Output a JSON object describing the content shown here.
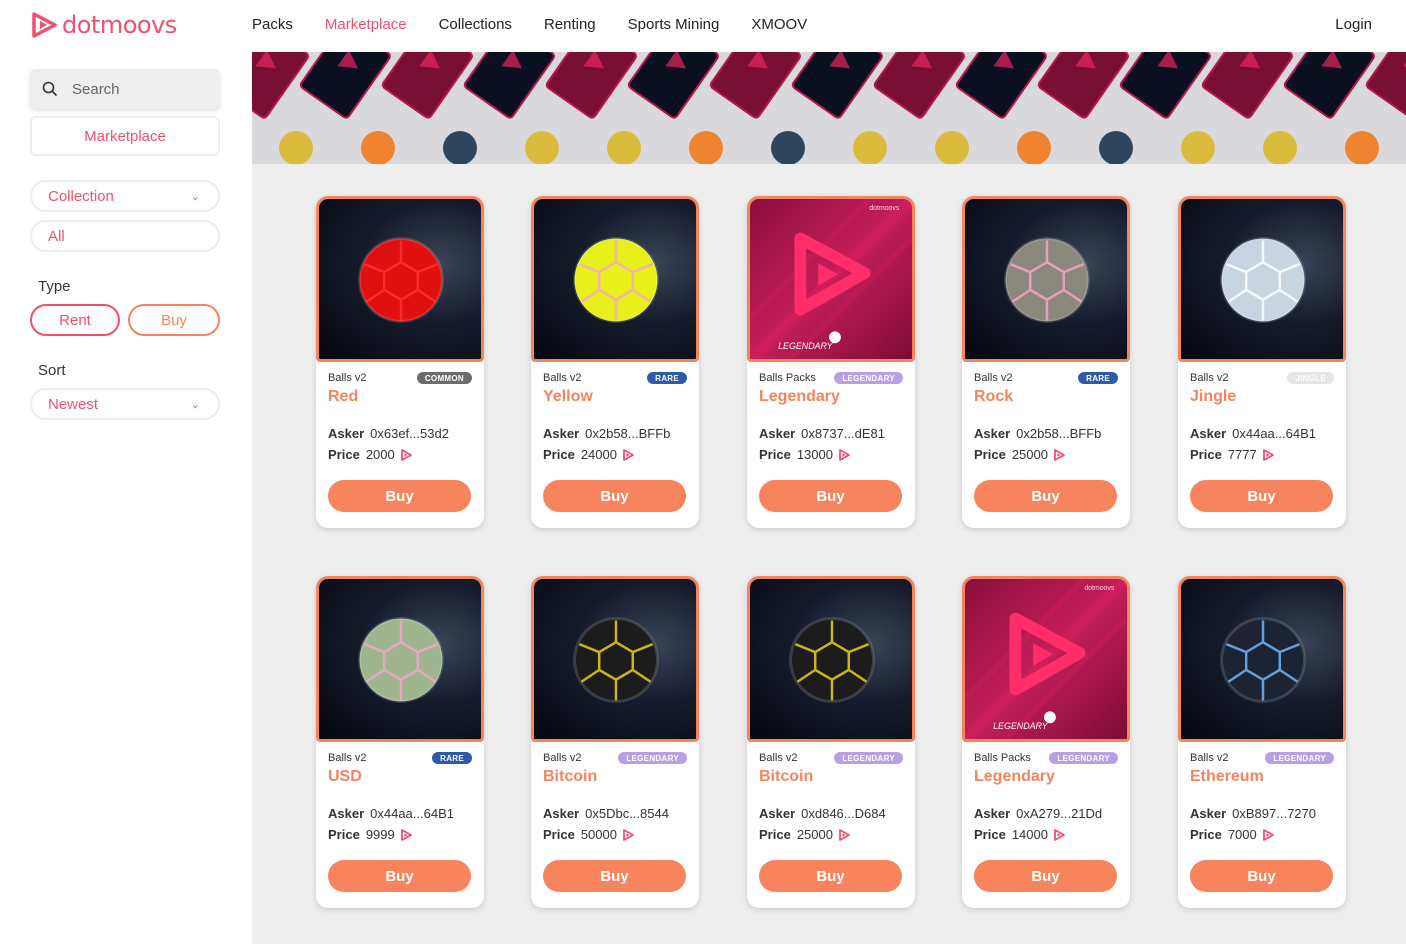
{
  "brand": {
    "name": "dotmoovs",
    "accent": "#f0506e",
    "orange": "#f8845e"
  },
  "nav": {
    "items": [
      "Packs",
      "Marketplace",
      "Collections",
      "Renting",
      "Sports Mining",
      "XMOOV"
    ],
    "active": "Marketplace",
    "login": "Login"
  },
  "sidebar": {
    "search_placeholder": "Search",
    "marketplace_button": "Marketplace",
    "collection_select": "Collection",
    "collection_value": "All",
    "type_label": "Type",
    "type_options": [
      "Rent",
      "Buy"
    ],
    "sort_label": "Sort",
    "sort_value": "Newest"
  },
  "cards": [
    {
      "collection": "Balls v2",
      "badge": "COMMON",
      "badge_color": "#6b6b6b",
      "name": "Red",
      "asker_label": "Asker",
      "asker": "0x63ef...53d2",
      "price_label": "Price",
      "price": "2000",
      "buy": "Buy",
      "art": "ball",
      "ball_color": "#e01010",
      "pattern": "#ff3030"
    },
    {
      "collection": "Balls v2",
      "badge": "RARE",
      "badge_color": "#2f5aa8",
      "name": "Yellow",
      "asker_label": "Asker",
      "asker": "0x2b58...BFFb",
      "price_label": "Price",
      "price": "24000",
      "buy": "Buy",
      "art": "ball",
      "ball_color": "#e8ef1a",
      "pattern": "#f5a9c8"
    },
    {
      "collection": "Balls Packs",
      "badge": "LEGENDARY",
      "badge_color": "#b9a0e6",
      "name": "Legendary",
      "asker_label": "Asker",
      "asker": "0x8737...dE81",
      "price_label": "Price",
      "price": "13000",
      "buy": "Buy",
      "art": "pack"
    },
    {
      "collection": "Balls v2",
      "badge": "RARE",
      "badge_color": "#2f5aa8",
      "name": "Rock",
      "asker_label": "Asker",
      "asker": "0x2b58...BFFb",
      "price_label": "Price",
      "price": "25000",
      "buy": "Buy",
      "art": "ball",
      "ball_color": "#8a877c",
      "pattern": "#f4a6c6"
    },
    {
      "collection": "Balls v2",
      "badge": "JINGLE",
      "badge_color": "#e6e6e6",
      "name": "Jingle",
      "asker_label": "Asker",
      "asker": "0x44aa...64B1",
      "price_label": "Price",
      "price": "7777",
      "buy": "Buy",
      "art": "ball",
      "ball_color": "#c8d4e0",
      "pattern": "#ffffff"
    },
    {
      "collection": "Balls v2",
      "badge": "RARE",
      "badge_color": "#2f5aa8",
      "name": "USD",
      "asker_label": "Asker",
      "asker": "0x44aa...64B1",
      "price_label": "Price",
      "price": "9999",
      "buy": "Buy",
      "art": "ball",
      "ball_color": "#9fb58e",
      "pattern": "#f4a6c6"
    },
    {
      "collection": "Balls v2",
      "badge": "LEGENDARY",
      "badge_color": "#b9a0e6",
      "name": "Bitcoin",
      "asker_label": "Asker",
      "asker": "0x5Dbc...8544",
      "price_label": "Price",
      "price": "50000",
      "buy": "Buy",
      "art": "ball",
      "ball_color": "#1c1c1c",
      "pattern": "#e8d21c"
    },
    {
      "collection": "Balls v2",
      "badge": "LEGENDARY",
      "badge_color": "#b9a0e6",
      "name": "Bitcoin",
      "asker_label": "Asker",
      "asker": "0xd846...D684",
      "price_label": "Price",
      "price": "25000",
      "buy": "Buy",
      "art": "ball",
      "ball_color": "#1c1c1c",
      "pattern": "#e8d21c"
    },
    {
      "collection": "Balls Packs",
      "badge": "LEGENDARY",
      "badge_color": "#b9a0e6",
      "name": "Legendary",
      "asker_label": "Asker",
      "asker": "0xA279...21Dd",
      "price_label": "Price",
      "price": "14000",
      "buy": "Buy",
      "art": "pack"
    },
    {
      "collection": "Balls v2",
      "badge": "LEGENDARY",
      "badge_color": "#b9a0e6",
      "name": "Ethereum",
      "asker_label": "Asker",
      "asker": "0xB897...7270",
      "price_label": "Price",
      "price": "7000",
      "buy": "Buy",
      "art": "ball",
      "ball_color": "#1c2434",
      "pattern": "#6fb6ff"
    }
  ],
  "pack_label": "LEGENDARY",
  "pack_brand": "dotmoovs"
}
